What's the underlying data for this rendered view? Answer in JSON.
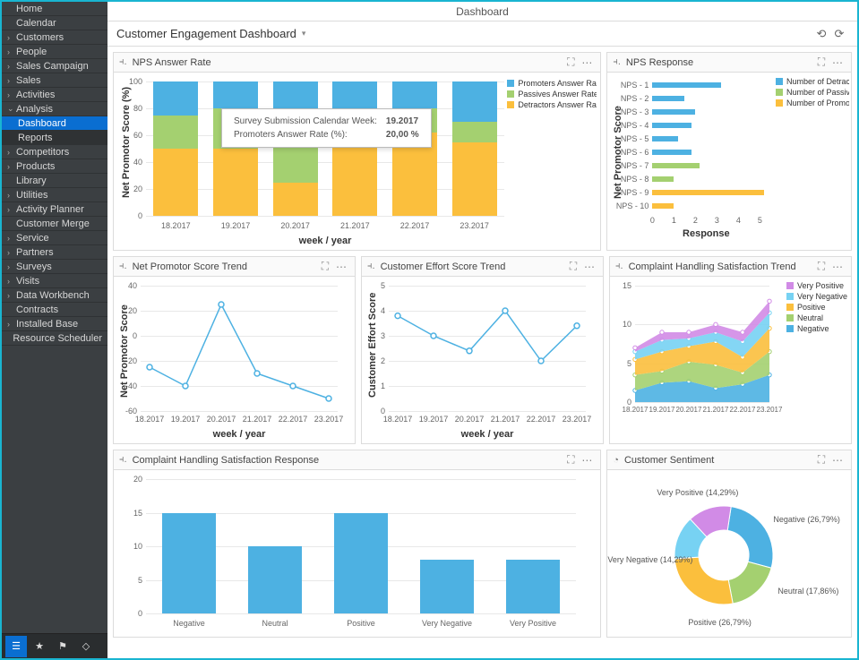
{
  "page_title": "Dashboard",
  "dashboard_title": "Customer Engagement Dashboard",
  "sidebar": {
    "items": [
      {
        "label": "Home",
        "exp": null
      },
      {
        "label": "Calendar",
        "exp": null
      },
      {
        "label": "Customers",
        "exp": ">"
      },
      {
        "label": "People",
        "exp": ">"
      },
      {
        "label": "Sales Campaign",
        "exp": ">"
      },
      {
        "label": "Sales",
        "exp": ">"
      },
      {
        "label": "Activities",
        "exp": ">"
      },
      {
        "label": "Analysis",
        "exp": "v",
        "children": [
          {
            "label": "Dashboard",
            "selected": true
          },
          {
            "label": "Reports"
          }
        ]
      },
      {
        "label": "Competitors",
        "exp": ">"
      },
      {
        "label": "Products",
        "exp": ">"
      },
      {
        "label": "Library",
        "exp": null
      },
      {
        "label": "Utilities",
        "exp": ">"
      },
      {
        "label": "Activity Planner",
        "exp": ">"
      },
      {
        "label": "Customer Merge",
        "exp": null
      },
      {
        "label": "Service",
        "exp": ">"
      },
      {
        "label": "Partners",
        "exp": ">"
      },
      {
        "label": "Surveys",
        "exp": ">"
      },
      {
        "label": "Visits",
        "exp": ">"
      },
      {
        "label": "Data Workbench",
        "exp": ">"
      },
      {
        "label": "Contracts",
        "exp": null
      },
      {
        "label": "Installed Base",
        "exp": ">"
      },
      {
        "label": "Resource Scheduler",
        "exp": null
      }
    ]
  },
  "panels": {
    "npsAnswerRate": {
      "title": "NPS Answer Rate",
      "ylabel": "Net Promotor Score (%)",
      "xlabel": "week / year",
      "legend": [
        "Promoters Answer Rate (%)",
        "Passives Answer Rate (%)",
        "Detractors Answer Rate (%)"
      ],
      "tooltip": {
        "line1_label": "Survey Submission Calendar Week:",
        "line1_value": "19.2017",
        "line2_label": "Promoters Answer Rate (%):",
        "line2_value": "20,00 %"
      }
    },
    "npsResponse": {
      "title": "NPS Response",
      "ylabel": "Net Promotor Score",
      "xlabel": "Response",
      "legend": [
        "Number of Detrac...",
        "Number of Passiv...",
        "Number of Promo..."
      ]
    },
    "npsTrend": {
      "title": "Net Promotor Score Trend",
      "ylabel": "Net Promotor Score",
      "xlabel": "week / year"
    },
    "cesTrend": {
      "title": "Customer Effort Score Trend",
      "ylabel": "Customer Effort Score",
      "xlabel": "week / year"
    },
    "complaintTrend": {
      "title": "Complaint Handling Satisfaction Trend",
      "legend": [
        "Negative",
        "Neutral",
        "Positive",
        "Very Negative",
        "Very Positive"
      ]
    },
    "complaintResponse": {
      "title": "Complaint Handling Satisfaction Response"
    },
    "sentiment": {
      "title": "Customer Sentiment",
      "labels": {
        "neg": "Negative (26,79%)",
        "neu": "Neutral (17,86%)",
        "pos": "Positive (26,79%)",
        "vn": "Very Negative (14,29%)",
        "vp": "Very Positive (14,29%)"
      }
    }
  },
  "chart_data": [
    {
      "id": "npsAnswerRate",
      "type": "bar",
      "stacked": true,
      "categories": [
        "18.2017",
        "19.2017",
        "20.2017",
        "21.2017",
        "22.2017",
        "23.2017"
      ],
      "series": [
        {
          "name": "Detractors Answer Rate (%)",
          "color": "#fbbf3d",
          "values": [
            50,
            50,
            25,
            55,
            62,
            55
          ]
        },
        {
          "name": "Passives Answer Rate (%)",
          "color": "#a4d070",
          "values": [
            25,
            30,
            35,
            15,
            18,
            15
          ]
        },
        {
          "name": "Promoters Answer Rate (%)",
          "color": "#4db1e2",
          "values": [
            25,
            20,
            40,
            30,
            20,
            30
          ]
        }
      ],
      "ylim": [
        0,
        100
      ],
      "yticks": [
        0,
        20,
        40,
        60,
        80,
        100
      ],
      "ylabel": "Net Promotor Score (%)",
      "xlabel": "week / year"
    },
    {
      "id": "npsResponse",
      "type": "bar",
      "horizontal": true,
      "categories": [
        "NPS - 1",
        "NPS - 2",
        "NPS - 3",
        "NPS - 4",
        "NPS - 5",
        "NPS - 6",
        "NPS - 7",
        "NPS - 8",
        "NPS - 9",
        "NPS - 10"
      ],
      "series": [
        {
          "name": "Number of Detrac...",
          "color": "#4db1e2",
          "values": [
            3.2,
            1.5,
            2.0,
            1.8,
            1.2,
            1.8,
            0,
            0,
            0,
            0
          ]
        },
        {
          "name": "Number of Passiv...",
          "color": "#a4d070",
          "values": [
            0,
            0,
            0,
            0,
            0,
            0,
            2.2,
            1.0,
            0,
            0
          ]
        },
        {
          "name": "Number of Promo...",
          "color": "#fbbf3d",
          "values": [
            0,
            0,
            0,
            0,
            0,
            0,
            0,
            0,
            5.2,
            1.0
          ]
        }
      ],
      "xlim": [
        0,
        5
      ],
      "xticks": [
        0,
        1,
        2,
        3,
        4,
        5
      ],
      "xlabel": "Response",
      "ylabel": "Net Promotor Score"
    },
    {
      "id": "npsTrend",
      "type": "line",
      "x": [
        "18.2017",
        "19.2017",
        "20.2017",
        "21.2017",
        "22.2017",
        "23.2017"
      ],
      "y": [
        -25,
        -40,
        25,
        -30,
        -40,
        -50
      ],
      "ylim": [
        -60,
        40
      ],
      "yticks": [
        -60,
        -40,
        -20,
        0,
        20,
        40
      ],
      "ylabel": "Net Promotor Score",
      "xlabel": "week / year"
    },
    {
      "id": "cesTrend",
      "type": "line",
      "x": [
        "18.2017",
        "19.2017",
        "20.2017",
        "21.2017",
        "22.2017",
        "23.2017"
      ],
      "y": [
        3.8,
        3.0,
        2.4,
        4.0,
        2.0,
        3.4
      ],
      "ylim": [
        0,
        5
      ],
      "yticks": [
        0,
        1,
        2,
        3,
        4,
        5
      ],
      "ylabel": "Customer Effort Score",
      "xlabel": "week / year"
    },
    {
      "id": "complaintTrend",
      "type": "area",
      "stacked": true,
      "x": [
        "18.2017",
        "19.2017",
        "20.2017",
        "21.2017",
        "22.2017",
        "23.2017"
      ],
      "series": [
        {
          "name": "Very Positive",
          "color": "#d18be6",
          "values": [
            0.5,
            1,
            0.8,
            1,
            1.2,
            1.5
          ]
        },
        {
          "name": "Very Negative",
          "color": "#77d2f3",
          "values": [
            1,
            1.5,
            1,
            1.2,
            2,
            2
          ]
        },
        {
          "name": "Positive",
          "color": "#fbbf3d",
          "values": [
            2,
            2.5,
            2,
            3,
            2,
            3
          ]
        },
        {
          "name": "Neutral",
          "color": "#a4d070",
          "values": [
            2,
            1.5,
            2.5,
            3,
            1.5,
            3
          ]
        },
        {
          "name": "Negative",
          "color": "#4db1e2",
          "values": [
            1.5,
            2.5,
            2.7,
            1.8,
            2.3,
            3.5
          ]
        }
      ],
      "ylim": [
        0,
        15
      ],
      "yticks": [
        0,
        5,
        10,
        15
      ]
    },
    {
      "id": "complaintResponse",
      "type": "bar",
      "categories": [
        "Negative",
        "Neutral",
        "Positive",
        "Very Negative",
        "Very Positive"
      ],
      "values": [
        15,
        10,
        15,
        8,
        8
      ],
      "color": "#4db1e2",
      "ylim": [
        0,
        20
      ],
      "yticks": [
        0,
        5,
        10,
        15,
        20
      ]
    },
    {
      "id": "sentiment",
      "type": "pie",
      "donut": true,
      "slices": [
        {
          "name": "Negative",
          "value": 26.79,
          "color": "#4db1e2"
        },
        {
          "name": "Neutral",
          "value": 17.86,
          "color": "#a4d070"
        },
        {
          "name": "Positive",
          "value": 26.79,
          "color": "#fbbf3d"
        },
        {
          "name": "Very Negative",
          "value": 14.29,
          "color": "#77d2f3"
        },
        {
          "name": "Very Positive",
          "value": 14.29,
          "color": "#d18be6"
        }
      ]
    }
  ]
}
